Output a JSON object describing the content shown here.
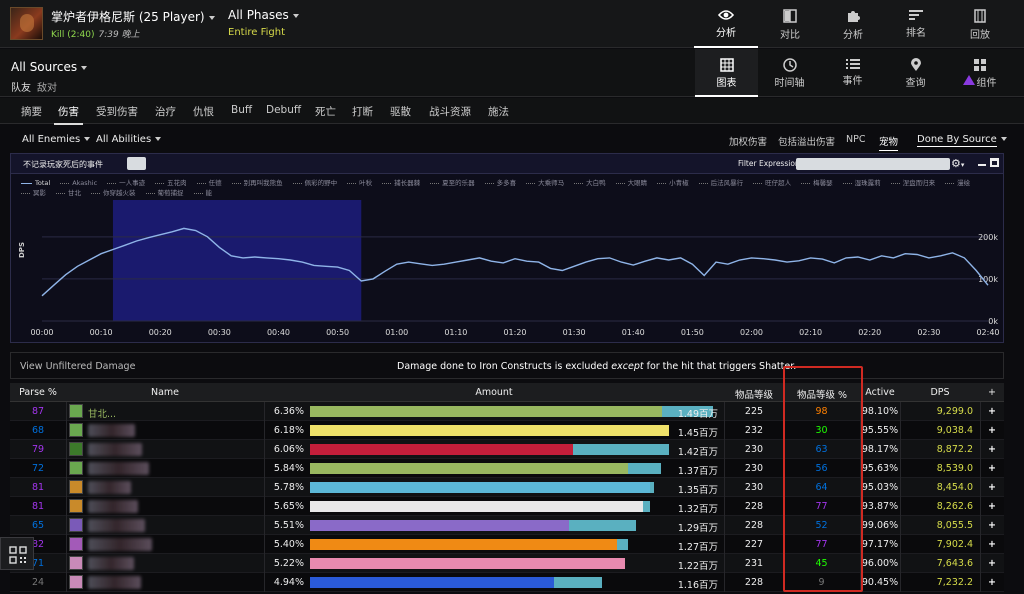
{
  "header": {
    "boss_title": "掌炉者伊格尼斯 (25 Player)",
    "kill_label": "Kill (2:40)",
    "time_label": "7:39 晚上",
    "phases_label": "All Phases",
    "phase_sub": "Entire Fight",
    "nav": [
      {
        "label": "分析",
        "icon": "eye-icon",
        "active": true
      },
      {
        "label": "对比",
        "icon": "compare-icon",
        "active": false
      },
      {
        "label": "分析",
        "icon": "puzzle-icon",
        "active": false
      },
      {
        "label": "排名",
        "icon": "rankings-icon",
        "active": false
      },
      {
        "label": "回放",
        "icon": "replay-icon",
        "active": false
      }
    ]
  },
  "sources": {
    "title": "All Sources",
    "friendly": "队友",
    "enemy": "敌对"
  },
  "views": [
    {
      "label": "图表",
      "icon": "table-grid-icon",
      "active": true
    },
    {
      "label": "时间轴",
      "icon": "clock-icon",
      "active": false
    },
    {
      "label": "事件",
      "icon": "list-icon",
      "active": false
    },
    {
      "label": "查询",
      "icon": "map-pin-icon",
      "active": false
    },
    {
      "label": "组件",
      "icon": "widgets-icon",
      "active": false
    }
  ],
  "tabs": [
    "摘要",
    "伤害",
    "受到伤害",
    "治疗",
    "仇恨",
    "Buff",
    "Debuff",
    "死亡",
    "打断",
    "驱散",
    "战斗资源",
    "施法"
  ],
  "active_tab": "伤害",
  "filters": {
    "enemies": "All Enemies",
    "abilities": "All Abilities",
    "right": [
      "加权伤害",
      "包括溢出伤害",
      "NPC",
      "宠物"
    ],
    "active_right": "宠物",
    "done_by": "Done By Source"
  },
  "graph": {
    "toolbar_label": "不记录玩家死后的事件",
    "filter_label": "Filter Expression:",
    "ylabel": "DPS",
    "legend": [
      "Total",
      "Akashic",
      "一人事迹",
      "五花肉",
      "任德",
      "别再叫我熊鱼",
      "佩彩的野中",
      "叶秋",
      "捕长器棘",
      "夏至的乐器",
      "多多喜",
      "大乘师马",
      "大白鸭",
      "大眼睛",
      "小青椒",
      "后法风暴行",
      "旺仔超人",
      "梅馨瑟",
      "湿珠露莉",
      "涅盘而归来",
      "漫绘",
      "冥影",
      "甘北",
      "你穿越火装",
      "葡萄捕捉",
      "能"
    ],
    "highlight_note": "visible"
  },
  "chart_data": {
    "type": "line",
    "title": "",
    "xlabel": "",
    "ylabel": "DPS",
    "x_ticks": [
      "00:00",
      "00:10",
      "00:20",
      "00:30",
      "00:40",
      "00:50",
      "01:00",
      "01:10",
      "01:20",
      "01:30",
      "01:40",
      "01:50",
      "02:00",
      "02:10",
      "02:20",
      "02:30",
      "02:40"
    ],
    "y_ticks": [
      "0k",
      "100k",
      "200k"
    ],
    "ylim": [
      0,
      240000
    ],
    "xlim": [
      0,
      160
    ],
    "highlight_range": [
      12,
      54
    ],
    "series": [
      {
        "name": "Total",
        "color": "#8fb4e8",
        "x": [
          0,
          2,
          4,
          6,
          8,
          10,
          12,
          14,
          16,
          18,
          20,
          22,
          24,
          26,
          28,
          30,
          32,
          34,
          36,
          38,
          40,
          42,
          44,
          46,
          48,
          50,
          52,
          54,
          56,
          58,
          60,
          62,
          64,
          66,
          68,
          70,
          72,
          74,
          76,
          78,
          80,
          82,
          84,
          86,
          88,
          90,
          92,
          94,
          96,
          98,
          100,
          102,
          104,
          106,
          108,
          110,
          112,
          114,
          116,
          118,
          120,
          122,
          124,
          126,
          128,
          130,
          132,
          134,
          136,
          138,
          140,
          142,
          144,
          146,
          148,
          150,
          152,
          154,
          156,
          158,
          160
        ],
        "y": [
          60000,
          85000,
          110000,
          130000,
          145000,
          160000,
          170000,
          180000,
          190000,
          198000,
          205000,
          212000,
          220000,
          215000,
          200000,
          175000,
          155000,
          150000,
          152000,
          150000,
          148000,
          145000,
          140000,
          132000,
          130000,
          128000,
          120000,
          95000,
          100000,
          118000,
          135000,
          140000,
          136000,
          132000,
          135000,
          140000,
          145000,
          150000,
          142000,
          138000,
          148000,
          142000,
          140000,
          125000,
          120000,
          130000,
          140000,
          148000,
          150000,
          140000,
          133000,
          142000,
          150000,
          145000,
          150000,
          135000,
          108000,
          140000,
          135000,
          145000,
          150000,
          148000,
          145000,
          140000,
          143000,
          150000,
          147000,
          138000,
          150000,
          152000,
          145000,
          155000,
          150000,
          160000,
          158000,
          150000,
          155000,
          162000,
          150000,
          120000,
          85000
        ]
      }
    ]
  },
  "note": {
    "unfiltered": "View Unfiltered Damage",
    "msg_prefix": "Damage done to Iron Constructs is excluded ",
    "msg_em": "except",
    "msg_suffix": " for the hit that triggers Shatter."
  },
  "table": {
    "headers": {
      "parse": "Parse %",
      "name": "Name",
      "amount": "Amount",
      "ilvl": "物品等级",
      "ilvl_pct": "物品等级 %",
      "active": "Active",
      "dps": "DPS",
      "plus": "+"
    },
    "rows": [
      {
        "parse": "87",
        "parse_color": "#a335ee",
        "name": "甘北...",
        "pct": "6.36%",
        "fill": 0.95,
        "overflow": 0.14,
        "bar_color": "#99b860",
        "amount": "1.49百万",
        "ilvl": "225",
        "ilvl_pct": "98",
        "ilvl_color": "#ff8000",
        "active": "98.10%",
        "dps": "9,299.0",
        "icon_color": "#6aa84f"
      },
      {
        "parse": "68",
        "parse_color": "#0070dd",
        "name": "",
        "pct": "6.18%",
        "fill": 0.97,
        "overflow": 0.0,
        "bar_color": "#f0e26a",
        "amount": "1.45百万",
        "ilvl": "232",
        "ilvl_pct": "30",
        "ilvl_color": "#1eff00",
        "active": "95.55%",
        "dps": "9,038.4",
        "icon_color": "#6aa84f"
      },
      {
        "parse": "79",
        "parse_color": "#a335ee",
        "name": "",
        "pct": "6.06%",
        "fill": 0.71,
        "overflow": 0.26,
        "bar_color": "#c41e3a",
        "amount": "1.42百万",
        "ilvl": "230",
        "ilvl_pct": "63",
        "ilvl_color": "#0070dd",
        "active": "98.17%",
        "dps": "8,872.2",
        "icon_color": "#3c7a2a"
      },
      {
        "parse": "72",
        "parse_color": "#0070dd",
        "name": "",
        "pct": "5.84%",
        "fill": 0.86,
        "overflow": 0.09,
        "bar_color": "#99b860",
        "amount": "1.37百万",
        "ilvl": "230",
        "ilvl_pct": "56",
        "ilvl_color": "#0070dd",
        "active": "95.63%",
        "dps": "8,539.0",
        "icon_color": "#6aa84f"
      },
      {
        "parse": "81",
        "parse_color": "#a335ee",
        "name": "",
        "pct": "5.78%",
        "fill": 0.92,
        "overflow": 0.01,
        "bar_color": "#5cb8d8",
        "amount": "1.35百万",
        "ilvl": "230",
        "ilvl_pct": "64",
        "ilvl_color": "#0070dd",
        "active": "95.03%",
        "dps": "8,454.0",
        "icon_color": "#c98a2a"
      },
      {
        "parse": "81",
        "parse_color": "#a335ee",
        "name": "",
        "pct": "5.65%",
        "fill": 0.9,
        "overflow": 0.02,
        "bar_color": "#e8e8e8",
        "amount": "1.32百万",
        "ilvl": "228",
        "ilvl_pct": "77",
        "ilvl_color": "#a335ee",
        "active": "93.87%",
        "dps": "8,262.6",
        "icon_color": "#c98a2a"
      },
      {
        "parse": "65",
        "parse_color": "#0070dd",
        "name": "",
        "pct": "5.51%",
        "fill": 0.7,
        "overflow": 0.18,
        "bar_color": "#8a6ac8",
        "amount": "1.29百万",
        "ilvl": "228",
        "ilvl_pct": "52",
        "ilvl_color": "#0070dd",
        "active": "99.06%",
        "dps": "8,055.5",
        "icon_color": "#7a5ab8"
      },
      {
        "parse": "82",
        "parse_color": "#a335ee",
        "name": "",
        "pct": "5.40%",
        "fill": 0.83,
        "overflow": 0.03,
        "bar_color": "#f08a14",
        "amount": "1.27百万",
        "ilvl": "227",
        "ilvl_pct": "77",
        "ilvl_color": "#a335ee",
        "active": "97.17%",
        "dps": "7,902.4",
        "icon_color": "#a35ab8"
      },
      {
        "parse": "71",
        "parse_color": "#0070dd",
        "name": "",
        "pct": "5.22%",
        "fill": 0.85,
        "overflow": 0.0,
        "bar_color": "#e88ab0",
        "amount": "1.22百万",
        "ilvl": "231",
        "ilvl_pct": "45",
        "ilvl_color": "#1eff00",
        "active": "96.00%",
        "dps": "7,643.6",
        "icon_color": "#c98ab8"
      },
      {
        "parse": "24",
        "parse_color": "#777777",
        "name": "",
        "pct": "4.94%",
        "fill": 0.66,
        "overflow": 0.13,
        "bar_color": "#2a5ad8",
        "amount": "1.16百万",
        "ilvl": "228",
        "ilvl_pct": "9",
        "ilvl_color": "#777777",
        "active": "90.45%",
        "dps": "7,232.2",
        "icon_color": "#c98ab8"
      }
    ]
  }
}
